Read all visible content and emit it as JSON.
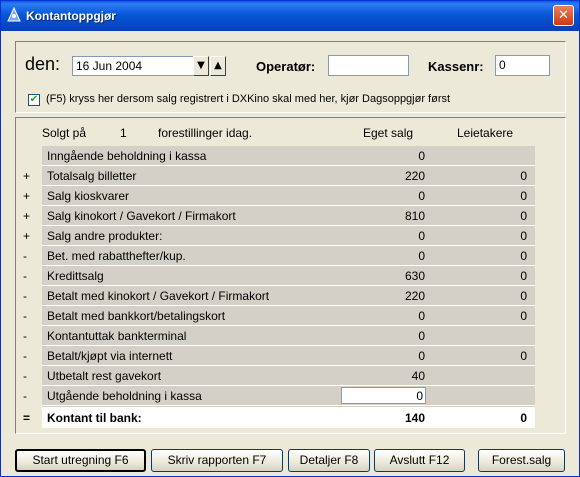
{
  "window": {
    "title": "Kontantoppgjør"
  },
  "top": {
    "den_label": "den:",
    "date_value": "16 Jun 2004",
    "spin_down": "▼",
    "spin_up": "▲",
    "operator_label": "Operatør:",
    "operator_value": "",
    "kassenr_label": "Kassenr:",
    "kassenr_value": "0",
    "checkbox_label": "(F5) kryss her dersom salg registrert i DXKino skal med her, kjør Dagsoppgjør først",
    "checkbox_checked": true
  },
  "summary": {
    "solgt_pa": "Solgt på",
    "count": "1",
    "forestillinger": "forestillinger idag.",
    "col_eget": "Eget salg",
    "col_leie": "Leietakere"
  },
  "rows": [
    {
      "sign": "",
      "label": "Inngående beholdning i kassa",
      "eget": "0",
      "leie": ""
    },
    {
      "sign": "+",
      "label": "Totalsalg billetter",
      "eget": "220",
      "leie": "0"
    },
    {
      "sign": "+",
      "label": "Salg kioskvarer",
      "eget": "0",
      "leie": "0"
    },
    {
      "sign": "+",
      "label": "Salg kinokort / Gavekort / Firmakort",
      "eget": "810",
      "leie": "0"
    },
    {
      "sign": "+",
      "label": "Salg andre produkter:",
      "eget": "0",
      "leie": "0"
    },
    {
      "sign": "-",
      "label": "Bet. med rabatthefter/kup.",
      "eget": "0",
      "leie": "0"
    },
    {
      "sign": "-",
      "label": "Kredittsalg",
      "eget": "630",
      "leie": "0"
    },
    {
      "sign": "-",
      "label": "Betalt med kinokort / Gavekort / Firmakort",
      "eget": "220",
      "leie": "0"
    },
    {
      "sign": "-",
      "label": "Betalt med bankkort/betalingskort",
      "eget": "0",
      "leie": "0"
    },
    {
      "sign": "-",
      "label": "Kontantuttak bankterminal",
      "eget": "0",
      "leie": ""
    },
    {
      "sign": "-",
      "label": "Betalt/kjøpt via internett",
      "eget": "0",
      "leie": "0"
    },
    {
      "sign": "-",
      "label": "Utbetalt rest gavekort",
      "eget": "40",
      "leie": ""
    },
    {
      "sign": "-",
      "label": "Utgående beholdning i kassa",
      "eget": "0",
      "leie": ""
    },
    {
      "sign": "=",
      "label": "Kontant til bank:",
      "eget": "140",
      "leie": "0"
    }
  ],
  "buttons": {
    "start": "Start utregning F6",
    "skriv": "Skriv rapporten F7",
    "detaljer": "Detaljer F8",
    "avslutt": "Avslutt F12",
    "forest": "Forest.salg"
  }
}
